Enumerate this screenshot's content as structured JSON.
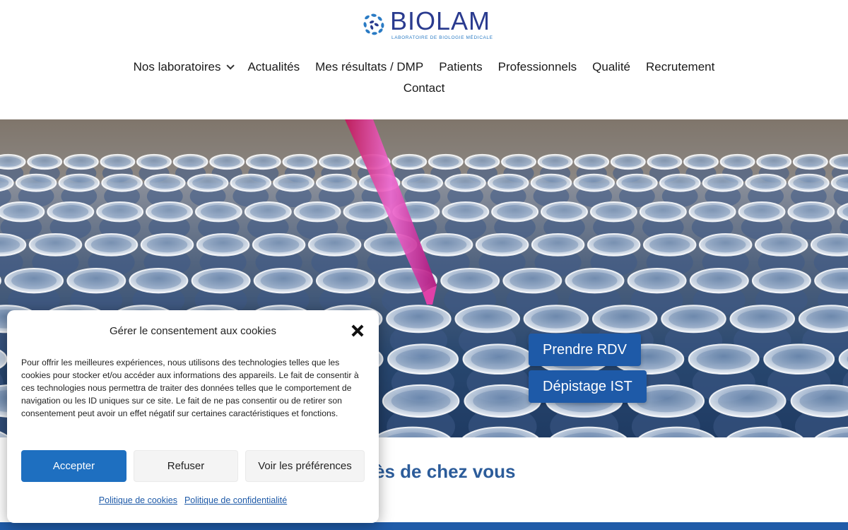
{
  "brand": {
    "name": "BIOLAM",
    "tagline": "LABORATOIRE DE BIOLOGIE MÉDICALE",
    "primary_color": "#1e5aa8",
    "logo_color": "#2a3b8f"
  },
  "nav": {
    "items": [
      {
        "label": "Nos laboratoires",
        "has_dropdown": true
      },
      {
        "label": "Actualités"
      },
      {
        "label": "Mes résultats / DMP"
      },
      {
        "label": "Patients"
      },
      {
        "label": "Professionnels"
      },
      {
        "label": "Qualité"
      },
      {
        "label": "Recrutement"
      }
    ],
    "second_row": [
      {
        "label": "Contact"
      }
    ]
  },
  "hero": {
    "image_subject": "laboratory-test-tubes-with-pipette",
    "buttons": {
      "rdv": "Prendre RDV",
      "ist": "Dépistage IST"
    }
  },
  "section": {
    "heading": "oratoire près de chez vous"
  },
  "cookie_dialog": {
    "title": "Gérer le consentement aux cookies",
    "text": "Pour offrir les meilleures expériences, nous utilisons des technologies telles que les cookies pour stocker et/ou accéder aux informations des appareils. Le fait de consentir à ces technologies nous permettra de traiter des données telles que le comportement de navigation ou les ID uniques sur ce site. Le fait de ne pas consentir ou de retirer son consentement peut avoir un effet négatif sur certaines caractéristiques et fonctions.",
    "accept": "Accepter",
    "refuse": "Refuser",
    "preferences": "Voir les préférences",
    "links": {
      "cookies_policy": "Politique de cookies",
      "privacy_policy": "Politique de confidentialité"
    },
    "close_icon": "close-icon"
  }
}
